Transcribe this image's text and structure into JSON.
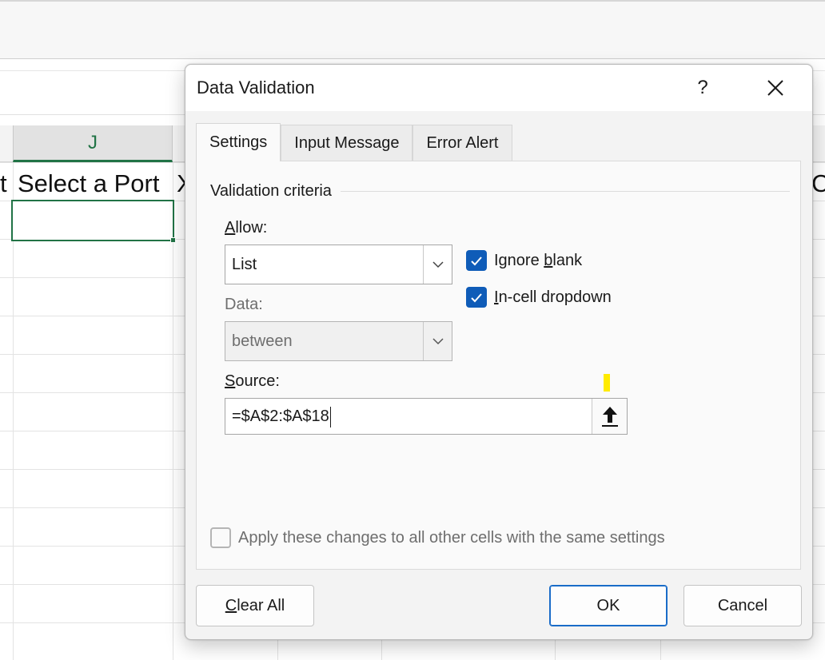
{
  "spreadsheet": {
    "column_header": "J",
    "left_cell_fragment": "t",
    "header_cell_text": "Select a Port",
    "next_cell_fragment": "X",
    "far_right_fragment": "C"
  },
  "dialog": {
    "title": "Data Validation",
    "help_label": "?",
    "tabs": [
      {
        "label": "Settings",
        "active": true
      },
      {
        "label": "Input Message",
        "active": false
      },
      {
        "label": "Error Alert",
        "active": false
      }
    ],
    "group_label": "Validation criteria",
    "allow": {
      "label_mnemonic": "A",
      "label_rest": "llow:",
      "value": "List"
    },
    "data": {
      "label": "Data:",
      "value": "between"
    },
    "ignore_blank": {
      "label_before": "Ignore ",
      "label_mnemonic": "b",
      "label_after": "lank",
      "checked": true
    },
    "in_cell_dropdown": {
      "label_mnemonic": "I",
      "label_rest": "n-cell dropdown",
      "checked": true
    },
    "source": {
      "label_mnemonic": "S",
      "label_rest": "ource:",
      "value": "=$A$2:$A$18"
    },
    "apply_all": {
      "label": "Apply these changes to all other cells with the same settings",
      "checked": false
    },
    "buttons": {
      "clear_all_mnemonic": "C",
      "clear_all_rest": "lear All",
      "ok": "OK",
      "cancel": "Cancel"
    }
  },
  "colors": {
    "excel_green": "#217346",
    "checkbox_blue": "#0f5cb8",
    "marker_yellow": "#ffeb00"
  }
}
